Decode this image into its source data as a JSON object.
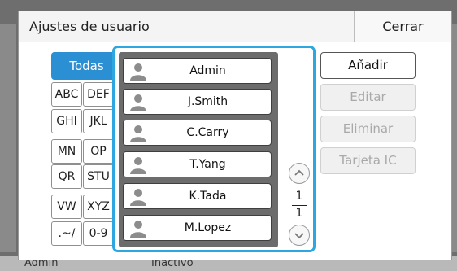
{
  "dialog": {
    "title": "Ajustes de usuario",
    "close_label": "Cerrar"
  },
  "filters": {
    "all_label": "Todas",
    "groups": [
      "ABC",
      "DEF",
      "GHI",
      "JKL",
      "MN",
      "OP",
      "QR",
      "STU",
      "VW",
      "XYZ",
      ".~/",
      "0-9"
    ]
  },
  "users": [
    "Admin",
    "J.Smith",
    "C.Carry",
    "T.Yang",
    "K.Tada",
    "M.Lopez"
  ],
  "pager": {
    "current": "1",
    "total": "1"
  },
  "actions": {
    "add_label": "Añadir",
    "edit_label": "Editar",
    "delete_label": "Eliminar",
    "ic_card_label": "Tarjeta IC"
  },
  "background": {
    "user_text": "Admin",
    "status_text": "Inactivo"
  },
  "colors": {
    "accent": "#2b8fd3",
    "list_border": "#2ea7e0"
  }
}
